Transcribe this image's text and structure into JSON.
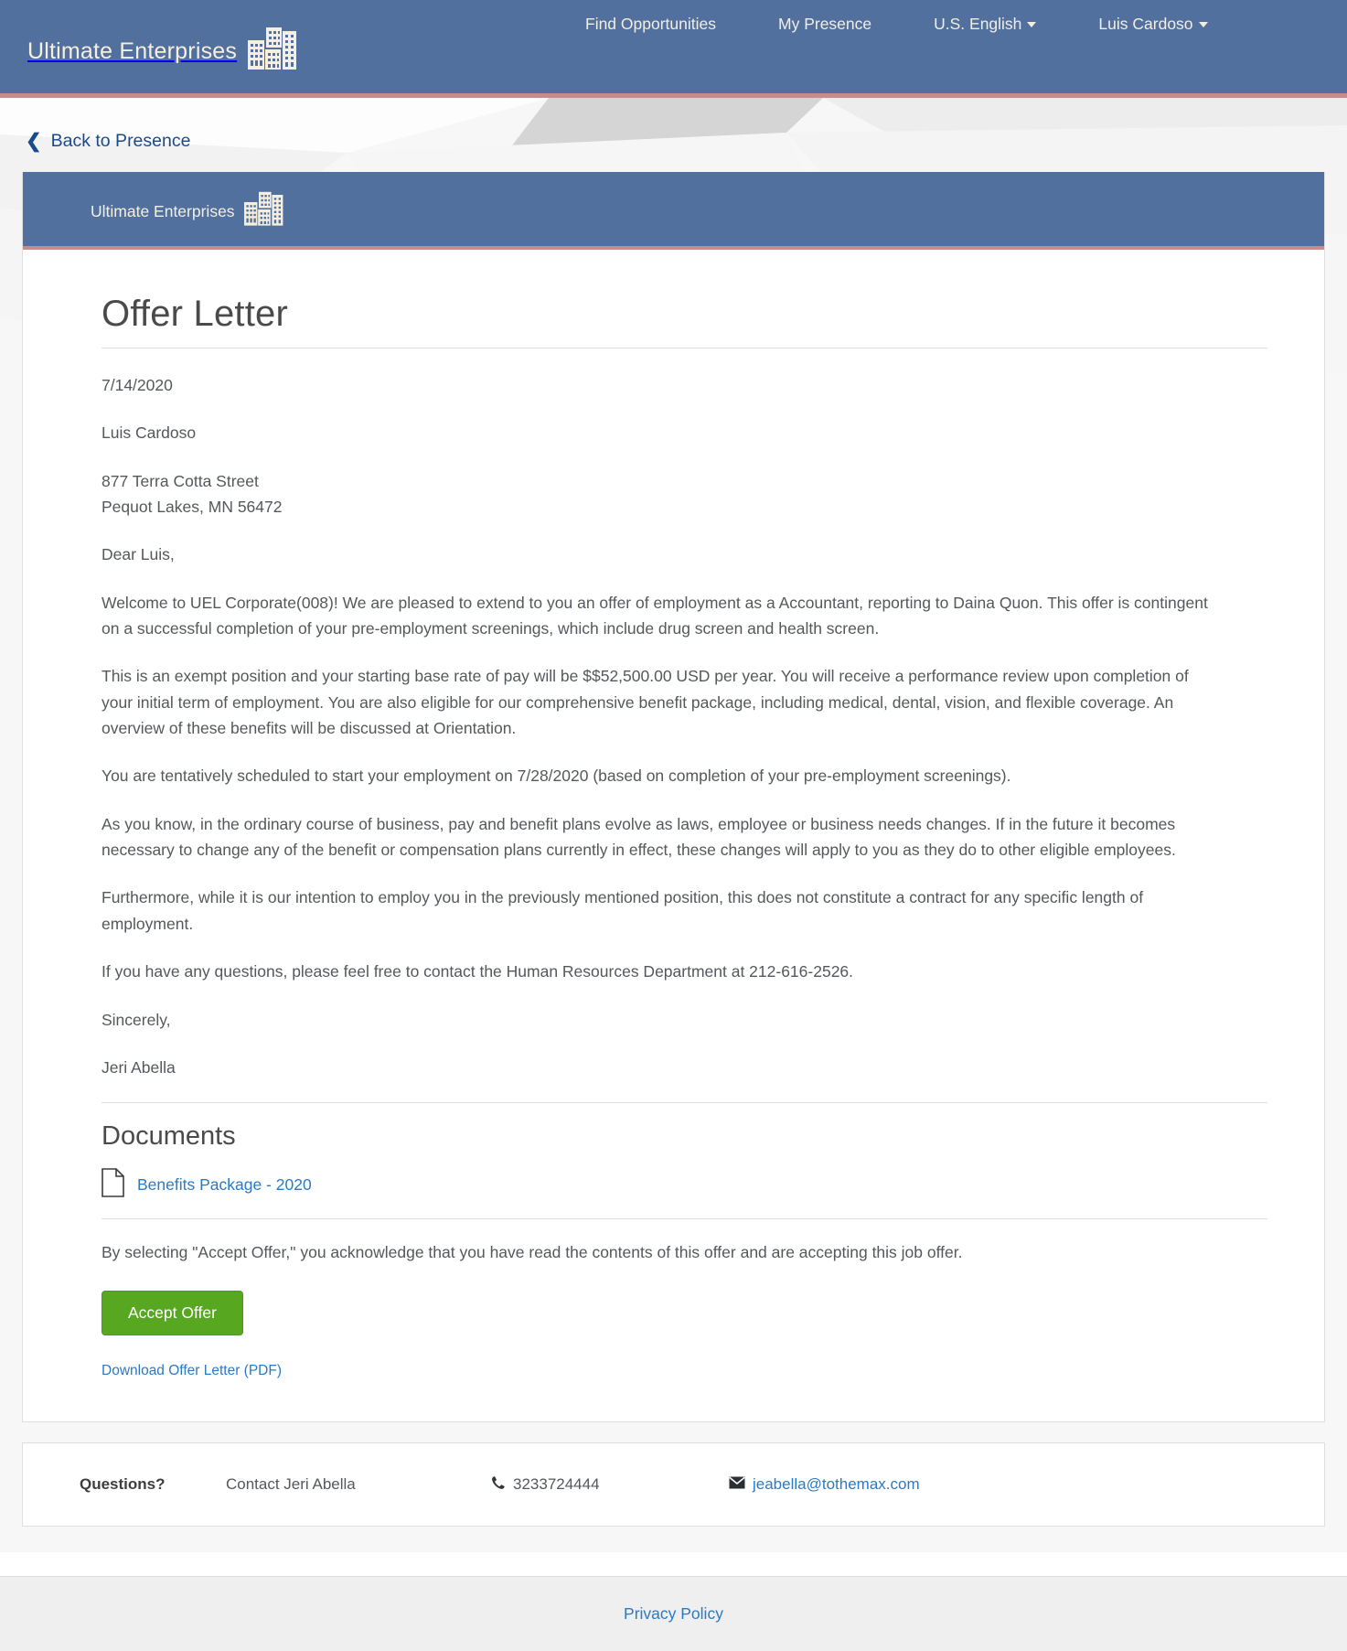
{
  "nav": {
    "brand": "Ultimate Enterprises",
    "brand_icon": "buildings-skyline-icon",
    "links": [
      {
        "label": "Find Opportunities",
        "caret": false
      },
      {
        "label": "My Presence",
        "caret": false
      },
      {
        "label": "U.S. English",
        "caret": true
      },
      {
        "label": "Luis Cardoso",
        "caret": true
      }
    ]
  },
  "back_link": {
    "icon": "chevron-left-icon",
    "label": "Back to Presence"
  },
  "card": {
    "header_brand": "Ultimate Enterprises",
    "title": "Offer Letter",
    "date": "7/14/2020",
    "recipient_name": "Luis Cardoso",
    "recipient_address": "877 Terra Cotta Street\nPequot Lakes, MN 56472",
    "salutation": "Dear Luis,",
    "paragraphs": [
      "Welcome to UEL Corporate(008)! We are pleased to extend to you an offer of employment as a Accountant, reporting to Daina Quon. This offer is contingent on a successful completion of your pre-employment screenings, which include drug screen and health screen.",
      "This is an exempt position and your starting base rate of pay will be $$52,500.00 USD per year. You will receive a performance review upon completion of your initial term of employment. You are also eligible for our comprehensive benefit package, including medical, dental, vision, and flexible coverage. An overview of these benefits will be discussed at Orientation.",
      "You are tentatively scheduled to start your employment on 7/28/2020 (based on completion of your pre-employment screenings).",
      "As you know, in the ordinary course of business, pay and benefit plans evolve as laws, employee or business needs changes. If in the future it becomes necessary to change any of the benefit or compensation plans currently in effect, these changes will apply to you as they do to other eligible employees.",
      "Furthermore, while it is our intention to employ you in the previously mentioned position, this does not constitute a contract for any specific length of employment.",
      "If you have any questions, please feel free to contact the Human Resources Department at 212-616-2526."
    ],
    "closing": "Sincerely,",
    "signer": "Jeri Abella",
    "documents_title": "Documents",
    "documents": [
      {
        "icon": "file-document-icon",
        "label": "Benefits Package - 2020"
      }
    ],
    "acknowledgement": "By selecting \"Accept Offer,\" you acknowledge that you have read the contents of this offer and are accepting this job offer.",
    "accept_button": "Accept Offer",
    "download_link": "Download Offer Letter (PDF)"
  },
  "questions": {
    "label": "Questions?",
    "contact": "Contact Jeri Abella",
    "phone_icon": "phone-icon",
    "phone": "3233724444",
    "email_icon": "envelope-icon",
    "email": "jeabella@tothemax.com"
  },
  "footer": {
    "privacy_policy": "Privacy Policy"
  },
  "colors": {
    "nav_blue": "#51709e",
    "accent_rose": "#c88b8b",
    "link_blue": "#2a7ac4",
    "back_link_blue": "#1b4a8b",
    "accept_green": "#57a721",
    "logo_cream": "#f6efdf",
    "page_bg": "#f7f7f7",
    "footer_bg": "#efefef"
  }
}
